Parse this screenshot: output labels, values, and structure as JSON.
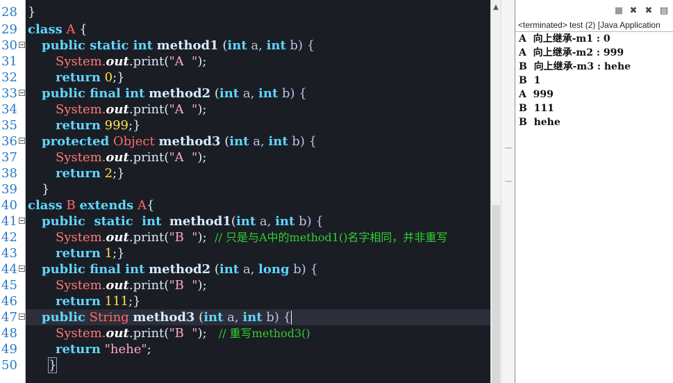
{
  "editor": {
    "line_numbers": [
      "28",
      "29",
      "30",
      "31",
      "32",
      "33",
      "34",
      "35",
      "36",
      "37",
      "38",
      "39",
      "40",
      "41",
      "42",
      "43",
      "44",
      "45",
      "46",
      "47",
      "48",
      "49",
      "50"
    ],
    "lines": {
      "l28": {
        "close": "}"
      },
      "l29": {
        "kw": "class",
        "name": "A",
        "brace": " {"
      },
      "l30": {
        "kw": "public static int",
        "method": "method1",
        "p1": "(",
        "t1": "int",
        "a": " a, ",
        "t2": "int",
        "b": " b) {"
      },
      "l31": {
        "sys": "System.",
        "out": "out",
        "print": ".print(",
        "str": "\"A  \"",
        "end": ");"
      },
      "l32": {
        "kw": "return",
        "num": "0",
        "end": ";}"
      },
      "l33": {
        "kw": "public final int",
        "method": "method2",
        "p1": "(",
        "t1": "int",
        "a": " a, ",
        "t2": "int",
        "b": " b) {"
      },
      "l34": {
        "sys": "System.",
        "out": "out",
        "print": ".print(",
        "str": "\"A  \"",
        "end": ");"
      },
      "l35": {
        "kw": "return",
        "num": "999",
        "end": ";}"
      },
      "l36": {
        "kw": "protected",
        "type": "Object",
        "method": "method3",
        "p1": "(",
        "t1": "int",
        "a": " a, ",
        "t2": "int",
        "b": " b) {"
      },
      "l37": {
        "sys": "System.",
        "out": "out",
        "print": ".print(",
        "str": "\"A  \"",
        "end": ");"
      },
      "l38": {
        "kw": "return",
        "num": "2",
        "end": ";}"
      },
      "l39": {
        "close": "}"
      },
      "l40": {
        "kw": "class",
        "name": "B",
        "kw2": "extends",
        "parent": "A",
        "brace": "{"
      },
      "l41": {
        "kw": "public  static  int",
        "method": "method1",
        "p1": "(",
        "t1": "int",
        "a": " a, ",
        "t2": "int",
        "b": " b) {"
      },
      "l42": {
        "sys": "System.",
        "out": "out",
        "print": ".print(",
        "str": "\"B  \"",
        "end": ");",
        "comment": "// 只是与A中的method1()名字相同，并非重写"
      },
      "l43": {
        "kw": "return",
        "num": "1",
        "end": ";}"
      },
      "l44": {
        "kw": "public final int",
        "method": "method2",
        "p1": "(",
        "t1": "int",
        "a": " a, ",
        "t2": "long",
        "b": " b) {"
      },
      "l45": {
        "sys": "System.",
        "out": "out",
        "print": ".print(",
        "str": "\"B  \"",
        "end": ");"
      },
      "l46": {
        "kw": "return",
        "num": "111",
        "end": ";}"
      },
      "l47": {
        "kw": "public",
        "type": "String",
        "method": "method3",
        "p1": "(",
        "t1": "int",
        "a": " a, ",
        "t2": "int",
        "b": " b) {"
      },
      "l48": {
        "sys": "System.",
        "out": "out",
        "print": ".print(",
        "str": "\"B  \"",
        "end": ");",
        "comment": "// 重写method3()"
      },
      "l49": {
        "kw": "return",
        "str": "\"hehe\"",
        "end": ";"
      },
      "l50": {
        "close": "}"
      }
    }
  },
  "console": {
    "title": "<terminated> test (2) [Java Application",
    "lines": [
      "A  向上继承-m1 : 0",
      "A  向上继承-m2 : 999",
      "B  向上继承-m3 : hehe",
      "B  1",
      "A  999",
      "B  111",
      "B  hehe"
    ],
    "toolbar_icons": [
      "terminate-icon",
      "remove-launch-icon",
      "remove-all-terminated-icon",
      "pin-console-icon",
      "display-selected-console-icon"
    ]
  },
  "colors": {
    "editor_bg": "#1b1d25",
    "keyword": "#5fd7ff",
    "class_name": "#ff6b6b",
    "string": "#ffa6c9",
    "number": "#ffe34d",
    "comment": "#2fd02f",
    "line_number": "#2b78c5"
  }
}
